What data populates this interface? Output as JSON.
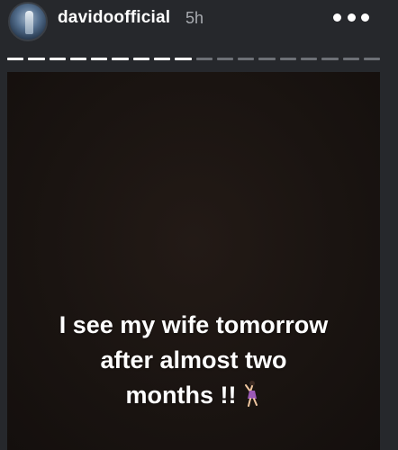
{
  "header": {
    "username": "davidoofficial",
    "time": "5h",
    "more_icon": "more-horizontal-icon"
  },
  "progress": {
    "total_segments": 18,
    "current_segment": 9
  },
  "story": {
    "caption_line1": "I see my wife tomorrow",
    "caption_line2": "after almost two",
    "caption_line3": "months !!",
    "emoji_icon": "woman-dancing-icon"
  },
  "colors": {
    "background": "#26282c",
    "story_bg": "#1a1411",
    "segment_active": "#ffffff",
    "segment_inactive": "#6d7076",
    "time_text": "#a8abb0"
  }
}
